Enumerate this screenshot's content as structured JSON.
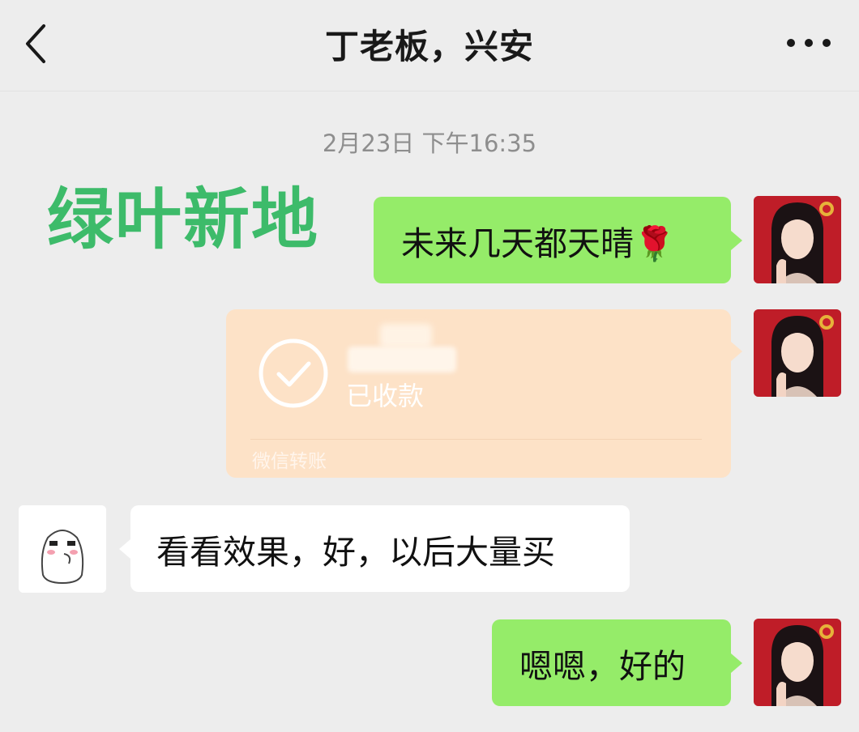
{
  "header": {
    "title": "丁老板，兴安"
  },
  "chat": {
    "timestamp": "2月23日 下午16:35",
    "watermark": "绿叶新地",
    "messages": [
      {
        "text": "未来几天都天晴🌹"
      },
      {
        "transfer_status": "已收款",
        "transfer_footer": "微信转账"
      },
      {
        "text": "看看效果，好，以后大量买"
      },
      {
        "text": "嗯嗯，好的"
      }
    ]
  },
  "colors": {
    "background": "#ededed",
    "outgoing_bubble": "#95ec69",
    "incoming_bubble": "#ffffff",
    "transfer_card": "#fde2c7",
    "watermark": "#3dbb6a"
  },
  "icons": {
    "back": "chevron-left-icon",
    "more": "more-dots-icon",
    "transfer": "check-circle-icon"
  }
}
